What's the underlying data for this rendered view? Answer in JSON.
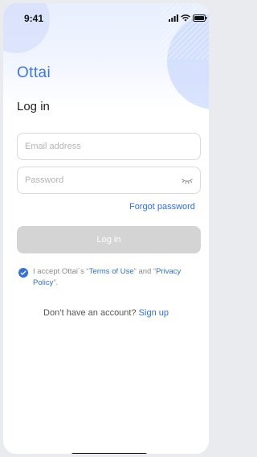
{
  "status_bar": {
    "time": "9:41",
    "icons": [
      "signal-icon",
      "wifi-icon",
      "battery-icon"
    ]
  },
  "brand": {
    "logo_text": "Ottai",
    "accent_color": "#3a78ea"
  },
  "page": {
    "title": "Log in"
  },
  "form": {
    "email_placeholder": "Email address",
    "email_value": "",
    "password_placeholder": "Password",
    "password_value": "",
    "password_toggle_icon": "eye-closed-icon",
    "forgot_label": "Forgot password",
    "login_label": "Log in",
    "login_enabled": false
  },
  "agreement": {
    "checked": true,
    "prefix": "I accept Ottai´s “",
    "terms_label": "Terms of Use",
    "middle": "” and “",
    "privacy_label": "Privacy Policy",
    "suffix": "”."
  },
  "signup": {
    "prompt": "Don’t have an account?",
    "link_label": "Sign up"
  },
  "colors": {
    "link": "#2f6fe0",
    "button_disabled": "#d4d4d4",
    "field_border": "#d9d9d9"
  }
}
